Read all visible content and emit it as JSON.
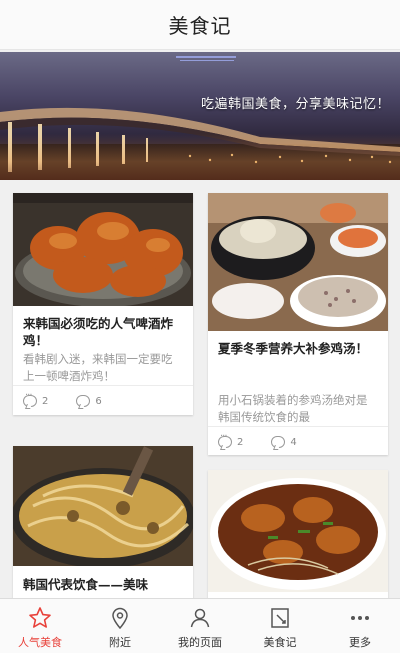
{
  "header": {
    "title": "美食记"
  },
  "banner": {
    "text": "吃遍韩国美食，分享美味记忆！"
  },
  "cards": [
    {
      "title": "来韩国必须吃的人气啤酒炸鸡！",
      "desc": "看韩剧入迷，来韩国一定要吃上一顿啤酒炸鸡！",
      "comments": "2",
      "likes": "6"
    },
    {
      "title": "夏季冬季营养大补参鸡汤！",
      "desc": "用小石锅装着的参鸡汤绝对是韩国传统饮食的最",
      "comments": "2",
      "likes": "4"
    },
    {
      "title": "韩国代表饮食——美味",
      "desc": "",
      "comments": "",
      "likes": ""
    },
    {
      "title": "",
      "desc": "",
      "comments": "",
      "likes": ""
    }
  ],
  "tabs": [
    {
      "label": "人气美食",
      "icon": "star-icon",
      "active": true
    },
    {
      "label": "附近",
      "icon": "location-pin-icon",
      "active": false
    },
    {
      "label": "我的页面",
      "icon": "user-icon",
      "active": false
    },
    {
      "label": "美食记",
      "icon": "note-icon",
      "active": false
    },
    {
      "label": "更多",
      "icon": "more-icon",
      "active": false
    }
  ],
  "colors": {
    "accent": "#e8413a",
    "background": "#f0f0f0",
    "card": "#ffffff",
    "muted_text": "#999999"
  }
}
